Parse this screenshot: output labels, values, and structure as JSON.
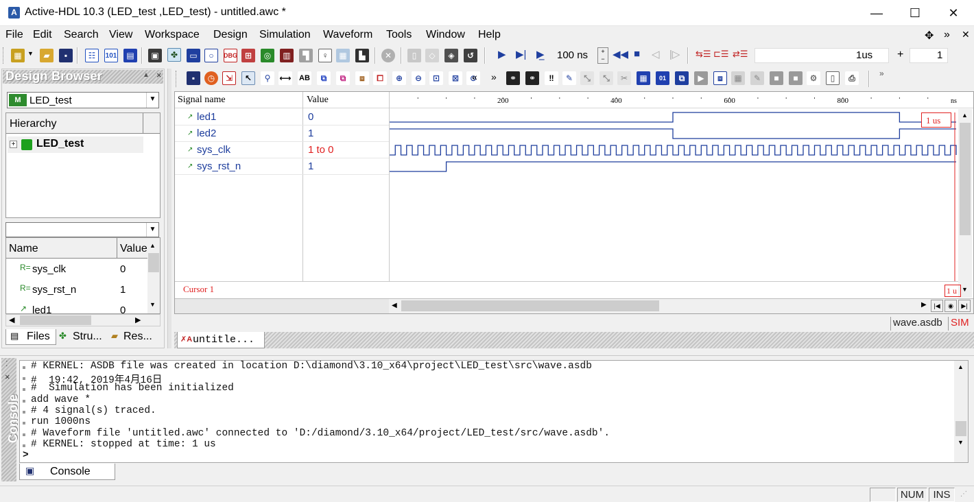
{
  "window": {
    "title": "Active-HDL 10.3 (LED_test ,LED_test) - untitled.awc *",
    "app_icon_letter": "A",
    "minimize_glyph": "—",
    "maximize_glyph": "☐",
    "close_glyph": "✕"
  },
  "menubar": {
    "items": [
      "File",
      "Edit",
      "Search",
      "View",
      "Workspace",
      "Design",
      "Simulation",
      "Waveform",
      "Tools",
      "Window",
      "Help"
    ],
    "right_glyphs": [
      "✥",
      "»",
      "✕"
    ]
  },
  "toolbar": {
    "sim_time": "100 ns",
    "cursor_time": "1us",
    "plus": "+",
    "step_count": "1"
  },
  "design_browser": {
    "title": "Design Browser",
    "design_selector": "LED_test",
    "hierarchy_header": "Hierarchy",
    "tree_root": "LED_test",
    "filter_value": "",
    "table_headers": [
      "Name",
      "Value"
    ],
    "objects": [
      {
        "icon": "R=",
        "name": "sys_clk",
        "value": "0"
      },
      {
        "icon": "R=",
        "name": "sys_rst_n",
        "value": "1"
      },
      {
        "icon": "↗",
        "name": "led1",
        "value": "0"
      }
    ],
    "tabs": [
      "Files",
      "Stru...",
      "Res..."
    ]
  },
  "waveform": {
    "columns": [
      "Signal name",
      "Value"
    ],
    "signals": [
      {
        "name": "led1",
        "value": "0",
        "value_color": "#1c3c9c"
      },
      {
        "name": "led2",
        "value": "1",
        "value_color": "#1c3c9c"
      },
      {
        "name": "sys_clk",
        "value": "1 to 0",
        "value_color": "#e02020"
      },
      {
        "name": "sys_rst_n",
        "value": "1",
        "value_color": "#1c3c9c"
      }
    ],
    "cursor_label": "Cursor 1",
    "cursor_time_tag": "1 us",
    "cursor_time_tag_bottom": "1 u",
    "timescale_labels": [
      "200",
      "400",
      "600",
      "800"
    ],
    "timescale_unit": "ns",
    "time_range_ns": [
      0,
      1000
    ],
    "cursor_at_ns": 1000,
    "status_file": "wave.asdb",
    "status_mode": "SIM",
    "doc_tab": "untitle..."
  },
  "console": {
    "side_title": "Console",
    "lines": [
      "# KERNEL: ASDB file was created in location D:\\diamond\\3.10_x64\\project\\LED_test\\src\\wave.asdb",
      "#  19:42, 2019年4月16日",
      "#  Simulation has been initialized",
      "add wave *",
      "# 4 signal(s) traced.",
      "run 1000ns",
      "# Waveform file 'untitled.awc' connected to 'D:/diamond/3.10_x64/project/LED_test/src/wave.asdb'.",
      "# KERNEL: stopped at time: 1 us"
    ],
    "prompt": ">",
    "tab": "Console"
  },
  "statusbar": {
    "num": "NUM",
    "ins": "INS"
  },
  "colors": {
    "signal_trace": "#1c3c9c",
    "cursor": "#e02020",
    "signal_text": "#1c3c9c"
  }
}
